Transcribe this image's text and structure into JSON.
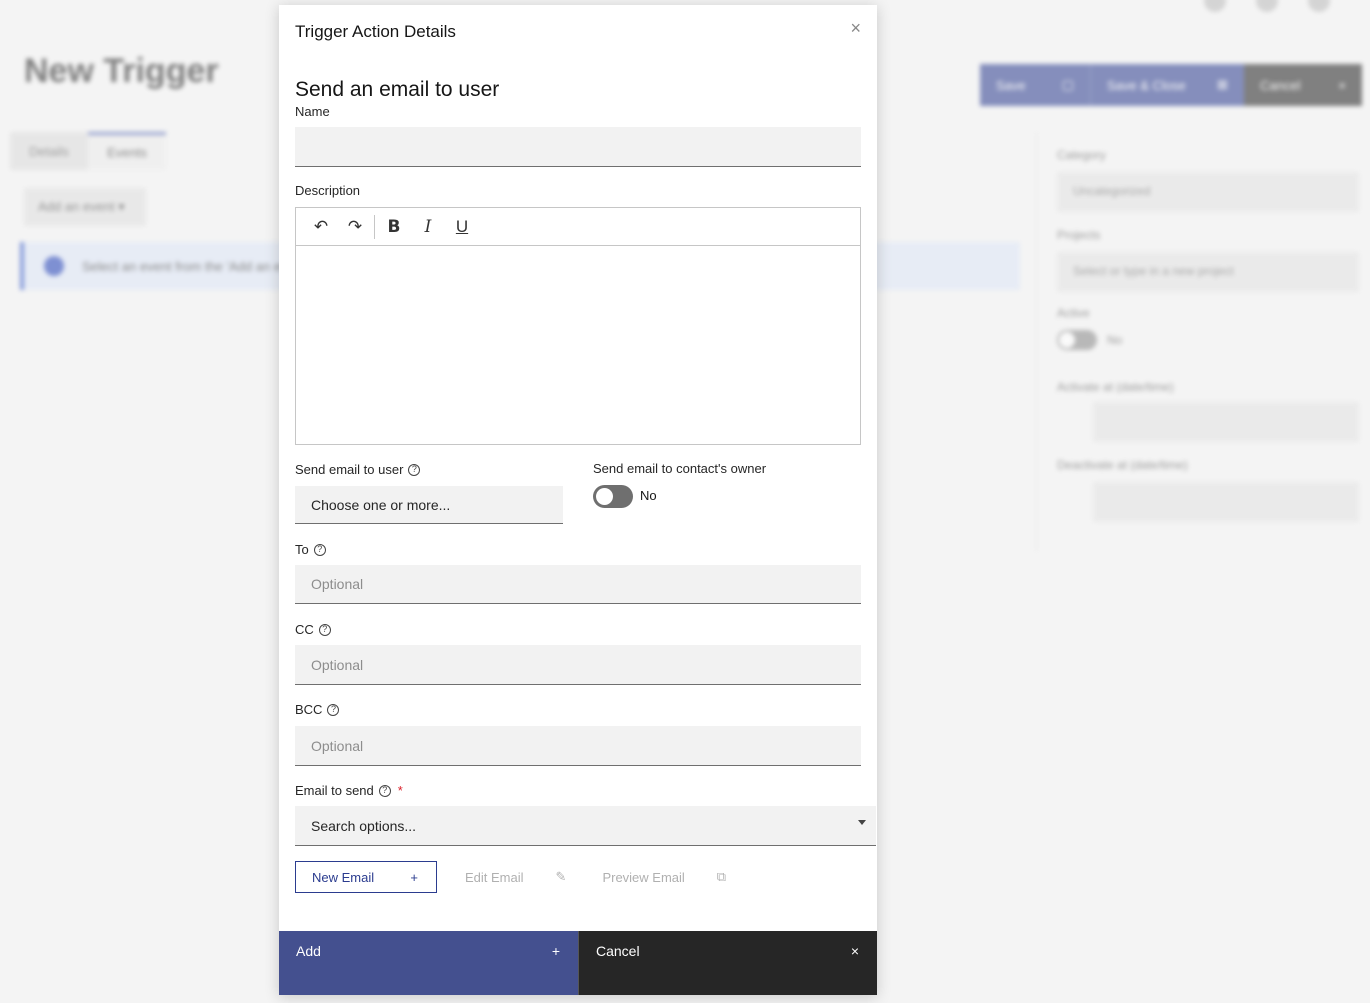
{
  "background": {
    "page_title": "New Trigger",
    "tabs": [
      "Details",
      "Events"
    ],
    "add_event": "Add an event ▾",
    "notice": "Select an event from the 'Add an event' menu",
    "actions": [
      {
        "label": "Save",
        "icon": "▢"
      },
      {
        "label": "Save & Close",
        "icon": "⊠"
      },
      {
        "label": "Cancel",
        "icon": "×"
      }
    ],
    "side": {
      "category_label": "Category",
      "category_value": "Uncategorized",
      "projects_label": "Projects",
      "projects_placeholder": "Select or type in a new project",
      "active_label": "Active",
      "active_value": "No",
      "activate_label": "Activate at (date/time)",
      "deactivate_label": "Deactivate at (date/time)"
    }
  },
  "modal": {
    "title": "Trigger Action Details",
    "close": "×",
    "section_title": "Send an email to user",
    "name_label": "Name",
    "description_label": "Description",
    "toolbar": {
      "undo": "↶",
      "redo": "↷",
      "bold": "B",
      "italic": "I",
      "underline": "U"
    },
    "send_to_user_label": "Send email to user",
    "send_to_user_placeholder": "Choose one or more...",
    "send_to_owner_label": "Send email to contact's owner",
    "send_to_owner_value": "No",
    "to_label": "To",
    "to_placeholder": "Optional",
    "cc_label": "CC",
    "cc_placeholder": "Optional",
    "bcc_label": "BCC",
    "bcc_placeholder": "Optional",
    "email_to_send_label": "Email to send",
    "required_mark": "*",
    "email_to_send_placeholder": "Search options...",
    "new_email": "New Email",
    "new_email_icon": "+",
    "edit_email": "Edit Email",
    "edit_email_icon": "✎",
    "preview_email": "Preview Email",
    "preview_email_icon": "⧉",
    "help_icon": "?",
    "footer": {
      "add": "Add",
      "add_icon": "+",
      "cancel": "Cancel",
      "cancel_icon": "×"
    }
  }
}
